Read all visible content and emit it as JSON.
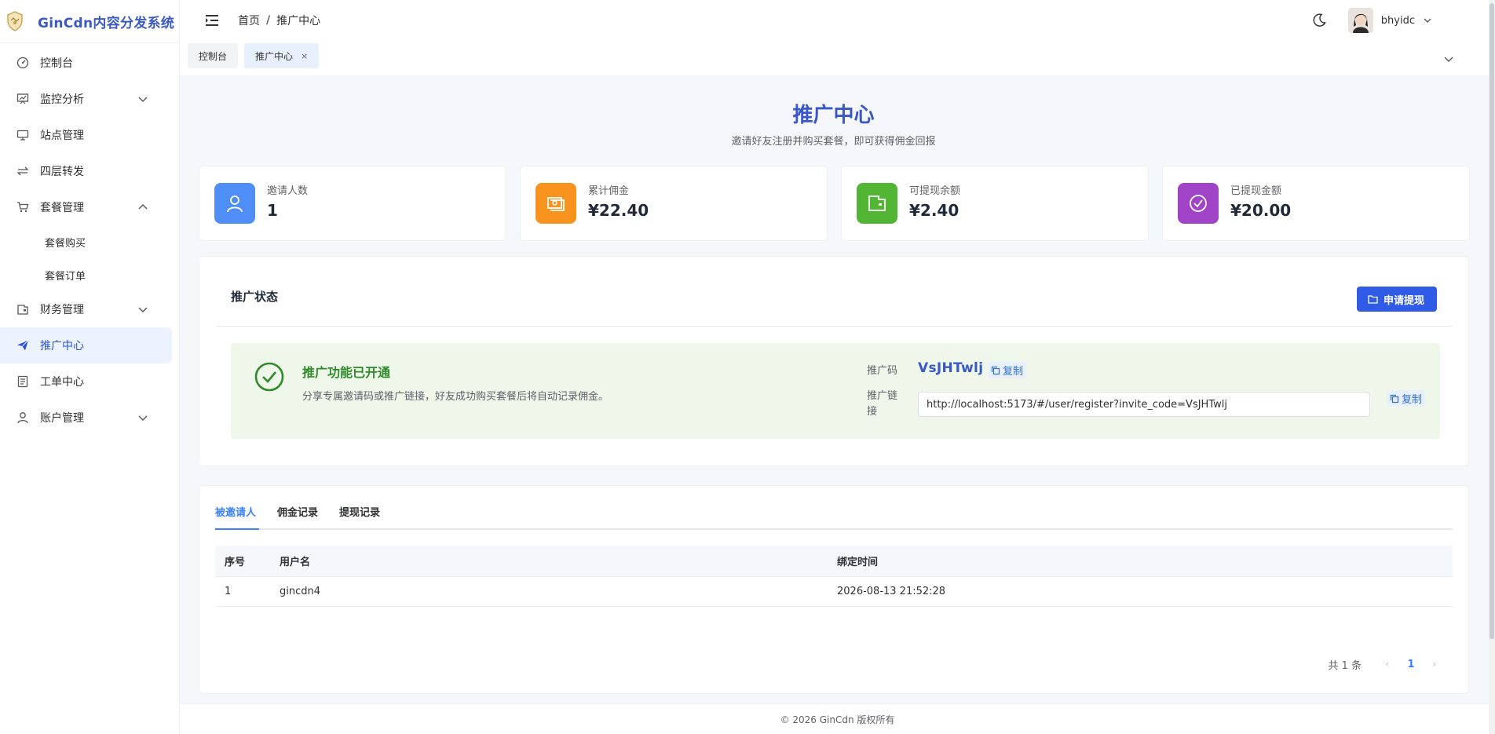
{
  "app": {
    "title": "GinCdn内容分发系统"
  },
  "sidebar": {
    "items": [
      {
        "label": "控制台",
        "icon": "dashboard-icon"
      },
      {
        "label": "监控分析",
        "icon": "chart-board-icon",
        "expandable": true,
        "expanded": false
      },
      {
        "label": "站点管理",
        "icon": "monitor-icon"
      },
      {
        "label": "四层转发",
        "icon": "forward-icon"
      },
      {
        "label": "套餐管理",
        "icon": "cart-icon",
        "expandable": true,
        "expanded": true,
        "children": [
          {
            "label": "套餐购买"
          },
          {
            "label": "套餐订单"
          }
        ]
      },
      {
        "label": "财务管理",
        "icon": "wallet-icon",
        "expandable": true,
        "expanded": false
      },
      {
        "label": "推广中心",
        "icon": "send-icon",
        "active": true
      },
      {
        "label": "工单中心",
        "icon": "ticket-icon"
      },
      {
        "label": "账户管理",
        "icon": "user-icon",
        "expandable": true,
        "expanded": false
      }
    ]
  },
  "header": {
    "breadcrumb": {
      "home": "首页",
      "separator": "/",
      "current": "推广中心"
    },
    "username": "bhyidc"
  },
  "tags": [
    {
      "label": "控制台",
      "active": false
    },
    {
      "label": "推广中心",
      "active": true,
      "close": "×"
    }
  ],
  "page": {
    "title": "推广中心",
    "subtitle": "邀请好友注册并购买套餐，即可获得佣金回报"
  },
  "stats": [
    {
      "label": "邀请人数",
      "value": "1",
      "color": "#4f8ef7",
      "icon": "user-icon"
    },
    {
      "label": "累计佣金",
      "value": "¥22.40",
      "color": "#f7931e",
      "icon": "money-icon"
    },
    {
      "label": "可提现余额",
      "value": "¥2.40",
      "color": "#52b533",
      "icon": "wallet-icon"
    },
    {
      "label": "已提现金额",
      "value": "¥20.00",
      "color": "#a043c6",
      "icon": "check-circle-icon"
    }
  ],
  "promo": {
    "section_title": "推广状态",
    "withdraw_button": "申请提现",
    "status_title": "推广功能已开通",
    "status_desc": "分享专属邀请码或推广链接，好友成功购买套餐后将自动记录佣金。",
    "code_label": "推广码",
    "code": "VsJHTwlj",
    "link_label": "推广链接",
    "link": "http://localhost:5173/#/user/register?invite_code=VsJHTwlj",
    "copy_label": "复制"
  },
  "records": {
    "tabs": [
      "被邀请人",
      "佣金记录",
      "提现记录"
    ],
    "active_tab": 0,
    "columns": [
      "序号",
      "用户名",
      "绑定时间"
    ],
    "rows": [
      [
        "1",
        "gincdn4",
        "2026-08-13 21:52:28"
      ]
    ],
    "pagination": {
      "total_text": "共 1 条",
      "current": "1",
      "prev": "‹",
      "next": "›"
    }
  },
  "footer": {
    "text": "© 2026 GinCdn 版权所有"
  },
  "colors": {
    "primary": "#2f5be7",
    "accent": "#3a59c4",
    "success": "#2f8a2a"
  }
}
